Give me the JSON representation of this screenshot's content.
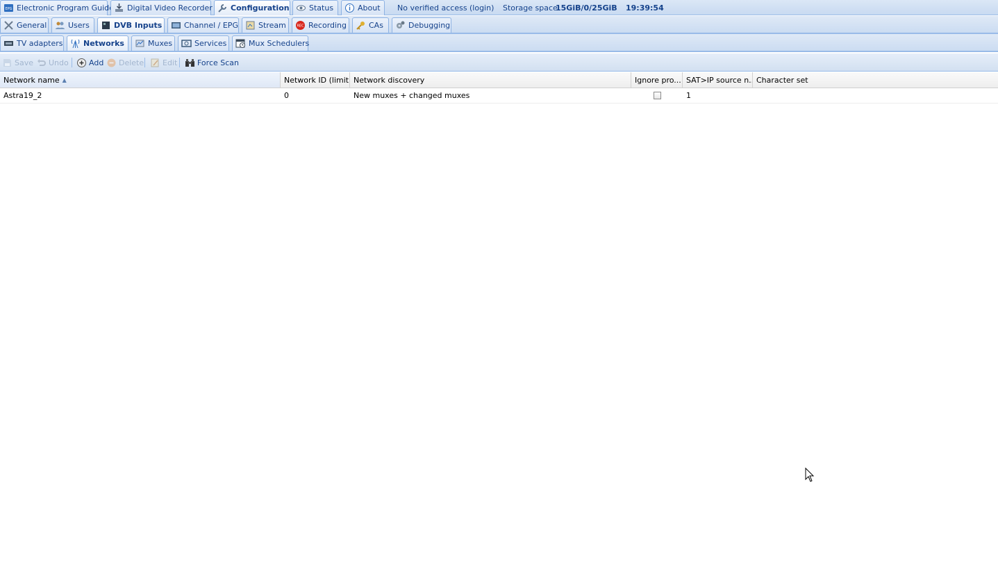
{
  "top_tabs": [
    {
      "label": "Electronic Program Guide",
      "icon": "epg-icon"
    },
    {
      "label": "Digital Video Recorder",
      "icon": "dvr-icon"
    },
    {
      "label": "Configuration",
      "icon": "wrench-icon",
      "active": true
    },
    {
      "label": "Status",
      "icon": "eye-icon"
    },
    {
      "label": "About",
      "icon": "info-icon"
    }
  ],
  "status_bar": {
    "access": "No verified access",
    "login": "(login)",
    "storage_label": "Storage space:",
    "storage_value": "15GiB/0/25GiB",
    "time": "19:39:54"
  },
  "config_tabs": [
    {
      "label": "General",
      "icon": "tools-icon"
    },
    {
      "label": "Users",
      "icon": "users-icon"
    },
    {
      "label": "DVB Inputs",
      "icon": "dvb-card-icon",
      "active": true
    },
    {
      "label": "Channel / EPG",
      "icon": "tv-icon"
    },
    {
      "label": "Stream",
      "icon": "stream-icon"
    },
    {
      "label": "Recording",
      "icon": "rec-icon"
    },
    {
      "label": "CAs",
      "icon": "key-icon"
    },
    {
      "label": "Debugging",
      "icon": "gears-icon"
    }
  ],
  "dvb_tabs": [
    {
      "label": "TV adapters",
      "icon": "adapter-icon"
    },
    {
      "label": "Networks",
      "icon": "antenna-icon",
      "active": true
    },
    {
      "label": "Muxes",
      "icon": "mux-icon"
    },
    {
      "label": "Services",
      "icon": "services-icon"
    },
    {
      "label": "Mux Schedulers",
      "icon": "scheduler-icon"
    }
  ],
  "toolbar": {
    "save": "Save",
    "undo": "Undo",
    "add": "Add",
    "delete": "Delete",
    "edit": "Edit",
    "force_scan": "Force Scan"
  },
  "grid": {
    "columns": [
      "Network name",
      "Network ID (limit...",
      "Network discovery",
      "Ignore pro...",
      "SAT>IP source n...",
      "Character set"
    ],
    "sorted_column": "Network name",
    "sort_direction": "ascending",
    "rows": [
      {
        "network_name": "Astra19_2",
        "network_id": "0",
        "discovery": "New muxes + changed muxes",
        "ignore_provider": false,
        "satip_source": "1",
        "charset": ""
      }
    ]
  },
  "colors": {
    "tab_text": "#15428b",
    "tab_border": "#99bbe8",
    "rec_red": "#d8261c"
  }
}
